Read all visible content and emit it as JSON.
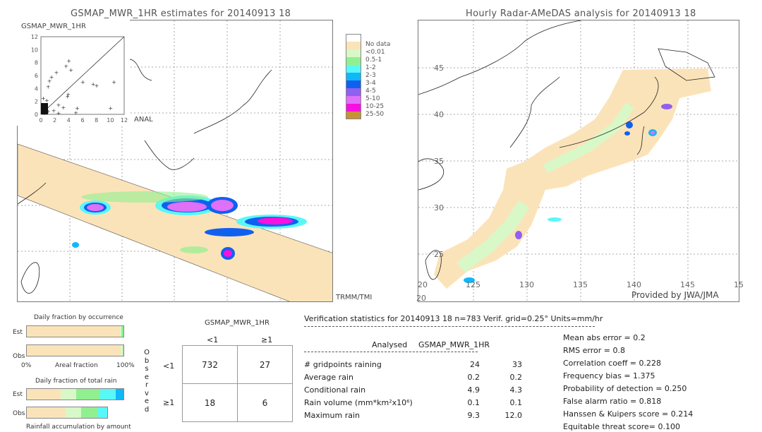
{
  "left_map": {
    "title": "GSMAP_MWR_1HR estimates for 20140913 18",
    "inset_title": "GSMAP_MWR_1HR",
    "inset_y_ticks": [
      "12",
      "10",
      "8",
      "6",
      "4",
      "2",
      "0"
    ],
    "inset_x_ticks": [
      "0",
      "2",
      "4",
      "6",
      "8",
      "10",
      "12"
    ],
    "inset_x_label": "ANAL",
    "sensor_label": "TRMM/TMI"
  },
  "legend": {
    "items": [
      {
        "label": "",
        "color": "#ffffff"
      },
      {
        "label": "No data",
        "color": "#fbe3b9"
      },
      {
        "label": "<0.01",
        "color": "#d8f8c8"
      },
      {
        "label": "0.5-1",
        "color": "#90f090"
      },
      {
        "label": "1-2",
        "color": "#58f8f8"
      },
      {
        "label": "2-3",
        "color": "#10b8f8"
      },
      {
        "label": "3-4",
        "color": "#1060f0"
      },
      {
        "label": "4-5",
        "color": "#9060f0"
      },
      {
        "label": "5-10",
        "color": "#e070f8"
      },
      {
        "label": "10-25",
        "color": "#f810e0"
      },
      {
        "label": "25-50",
        "color": "#c89038"
      }
    ]
  },
  "right_map": {
    "title": "Hourly Radar-AMeDAS analysis for 20140913 18",
    "lat_labels": [
      "45",
      "40",
      "35",
      "30",
      "25",
      "20"
    ],
    "lon_labels": [
      "125",
      "130",
      "135",
      "140",
      "145",
      "15"
    ],
    "lon_start_label": "20",
    "credit": "Provided by JWA/JMA"
  },
  "occurrence": {
    "title": "Daily fraction by occurrence",
    "est_label": "Est",
    "obs_label": "Obs",
    "axis_left": "0%",
    "axis_mid": "Areal fraction",
    "axis_right": "100%"
  },
  "total_rain": {
    "title": "Daily fraction of total rain",
    "est_label": "Est",
    "obs_label": "Obs",
    "caption": "Rainfall accumulation by amount"
  },
  "contingency": {
    "title": "GSMAP_MWR_1HR",
    "col_headers": [
      "<1",
      "≥1"
    ],
    "row_headers": [
      "<1",
      "≥1"
    ],
    "side_label": [
      "O",
      "b",
      "s",
      "e",
      "r",
      "v",
      "e",
      "d"
    ],
    "cells": [
      [
        "732",
        "27"
      ],
      [
        "18",
        "6"
      ]
    ]
  },
  "verification": {
    "header": "Verification statistics for 20140913 18   n=783   Verif. grid=0.25°   Units=mm/hr",
    "col_analysed": "Analysed",
    "col_gsmap": "GSMAP_MWR_1HR",
    "rows": [
      {
        "label": "# gridpoints raining",
        "analysed": "24",
        "gsmap": "33"
      },
      {
        "label": "Average rain",
        "analysed": "0.2",
        "gsmap": "0.2"
      },
      {
        "label": "Conditional rain",
        "analysed": "4.9",
        "gsmap": "4.3"
      },
      {
        "label": "Rain volume (mm*km²x10⁶)",
        "analysed": "0.1",
        "gsmap": "0.1"
      },
      {
        "label": "Maximum rain",
        "analysed": "9.3",
        "gsmap": "12.0"
      }
    ],
    "scores": [
      "Mean abs error = 0.2",
      "RMS error = 0.8",
      "Correlation coeff = 0.228",
      "Frequency bias = 1.375",
      "Probability of detection = 0.250",
      "False alarm ratio = 0.818",
      "Hanssen & Kuipers score = 0.214",
      "Equitable threat score= 0.100"
    ]
  },
  "chart_data": [
    {
      "type": "scatter",
      "title": "GSMAP_MWR_1HR",
      "xlabel": "ANAL",
      "ylabel": "GSMAP_MWR_1HR",
      "xlim": [
        0,
        12
      ],
      "ylim": [
        0,
        12
      ],
      "note": "approximate scatter of estimated vs analysed rain (mm/hr) with 1:1 line",
      "points": [
        [
          0.2,
          0.3
        ],
        [
          0.5,
          1.0
        ],
        [
          0.3,
          2.5
        ],
        [
          0.8,
          2.2
        ],
        [
          1.2,
          5.2
        ],
        [
          1.0,
          4.3
        ],
        [
          1.5,
          5.8
        ],
        [
          2.2,
          6.5
        ],
        [
          2.5,
          1.5
        ],
        [
          3.2,
          1.1
        ],
        [
          3.6,
          7.5
        ],
        [
          4.0,
          8.3
        ],
        [
          4.3,
          6.9
        ],
        [
          3.8,
          2.8
        ],
        [
          3.9,
          3.1
        ],
        [
          5.2,
          1.0
        ],
        [
          5.0,
          0.3
        ],
        [
          6.0,
          5.0
        ],
        [
          7.5,
          4.7
        ],
        [
          8.0,
          4.5
        ],
        [
          10.5,
          5.0
        ],
        [
          10.0,
          1.0
        ],
        [
          1.0,
          0.5
        ],
        [
          0.5,
          0.2
        ],
        [
          1.8,
          0.6
        ],
        [
          2.5,
          0.2
        ]
      ]
    },
    {
      "type": "bar",
      "title": "Daily fraction by occurrence",
      "categories": [
        "Est",
        "Obs"
      ],
      "series": [
        {
          "name": "No data/dry",
          "values": [
            0.96,
            0.97
          ]
        },
        {
          "name": "<0.01",
          "values": [
            0.02,
            0.02
          ]
        },
        {
          "name": "0.5-1",
          "values": [
            0.02,
            0.01
          ]
        }
      ],
      "xlabel": "Areal fraction",
      "xlim": [
        0,
        1
      ]
    },
    {
      "type": "bar",
      "title": "Daily fraction of total rain",
      "categories": [
        "Est",
        "Obs"
      ],
      "series": [
        {
          "name": "<0.01",
          "values": [
            0.35,
            0.4
          ]
        },
        {
          "name": "0.5-1",
          "values": [
            0.16,
            0.16
          ]
        },
        {
          "name": "1-2",
          "values": [
            0.25,
            0.17
          ]
        },
        {
          "name": "2-3",
          "values": [
            0.16,
            0.1
          ]
        },
        {
          "name": "3-4",
          "values": [
            0.08,
            0.0
          ]
        }
      ],
      "xlabel": "Rainfall accumulation by amount"
    }
  ]
}
